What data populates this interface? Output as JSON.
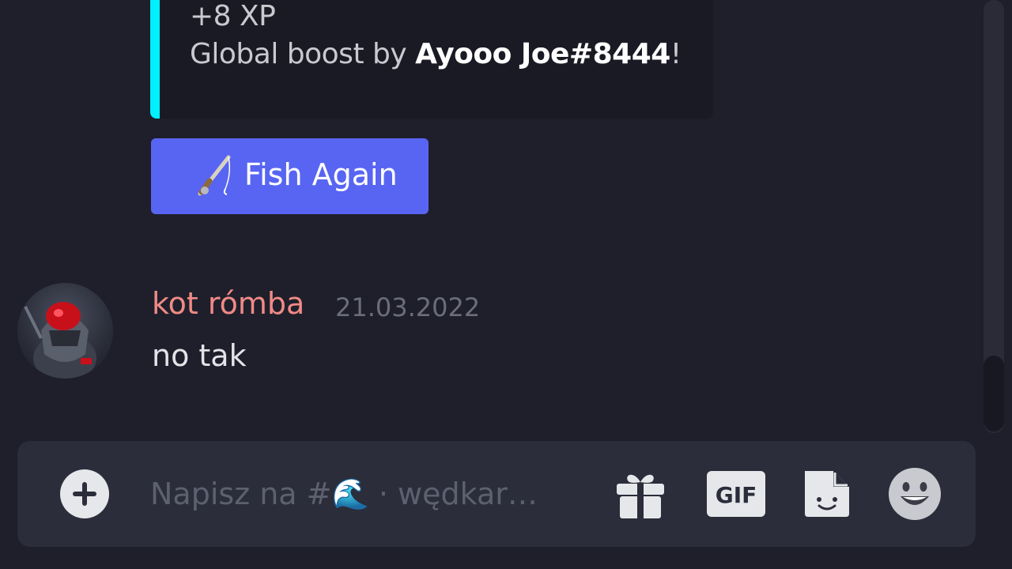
{
  "embed": {
    "xp_text": "+8 XP",
    "boost_prefix": "Global boost by ",
    "boost_user": "Ayooo Joe#8444",
    "boost_suffix": "!",
    "accent_color": "#00f0ff"
  },
  "fish_button": {
    "label": "Fish Again",
    "icon": "fishing-rod-icon",
    "color": "#5865f2"
  },
  "message": {
    "username": "kot rómba",
    "username_color": "#f08a86",
    "timestamp": "21.03.2022",
    "text": "no tak"
  },
  "composer": {
    "placeholder": "Napisz na #🌊 · wędkar…",
    "icons": [
      "plus-circle-icon",
      "gift-icon",
      "gif-icon",
      "sticker-icon",
      "emoji-icon"
    ],
    "gif_label": "GIF"
  }
}
